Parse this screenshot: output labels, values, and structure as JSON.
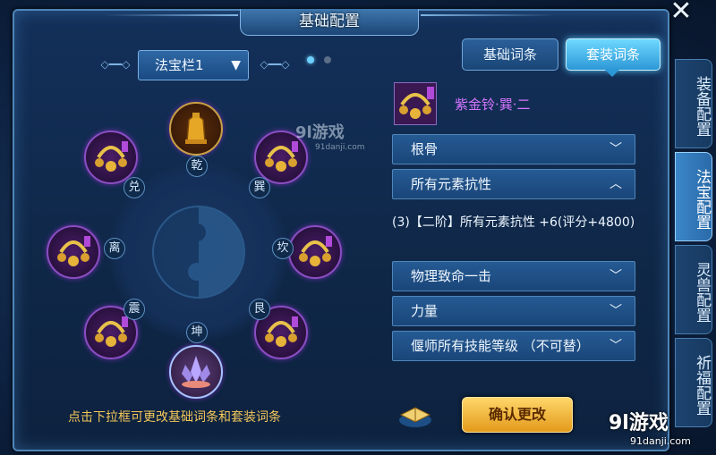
{
  "window": {
    "title": "基础配置",
    "close_label": "✕"
  },
  "selector": {
    "value": "法宝栏1",
    "page_count": 2,
    "active_page": 1
  },
  "wheel": {
    "trigrams": [
      "乾",
      "巽",
      "坎",
      "艮",
      "坤",
      "震",
      "离",
      "兑"
    ],
    "slots": [
      {
        "pos": "乾",
        "icon": "golden-bell-icon"
      },
      {
        "pos": "巽",
        "icon": "purple-bell-necklace-icon"
      },
      {
        "pos": "坎",
        "icon": "purple-bell-necklace-icon"
      },
      {
        "pos": "艮",
        "icon": "purple-bell-necklace-icon"
      },
      {
        "pos": "坤",
        "icon": "crystal-lotus-icon"
      },
      {
        "pos": "震",
        "icon": "purple-bell-necklace-icon"
      },
      {
        "pos": "离",
        "icon": "purple-bell-necklace-icon"
      },
      {
        "pos": "兑",
        "icon": "purple-bell-necklace-icon"
      }
    ]
  },
  "hint": "点击下拉框可更改基础词条和套装词条",
  "tabs": {
    "basic": "基础词条",
    "set": "套装词条",
    "active": "set"
  },
  "item": {
    "name": "紫金铃·巽·二",
    "icon": "purple-bell-necklace-icon"
  },
  "attributes": [
    {
      "label": "根骨",
      "expanded": false
    },
    {
      "label": "所有元素抗性",
      "expanded": true,
      "detail": "(3)【二阶】所有元素抗性 +6(评分+4800)"
    },
    {
      "label": "物理致命一击",
      "expanded": false
    },
    {
      "label": "力量",
      "expanded": false
    },
    {
      "label": "偃师所有技能等级 （不可替）",
      "expanded": false
    }
  ],
  "confirm_label": "确认更改",
  "side_tabs": [
    {
      "label": "装备配置",
      "active": false
    },
    {
      "label": "法宝配置",
      "active": true
    },
    {
      "label": "灵兽配置",
      "active": false
    },
    {
      "label": "祈福配置",
      "active": false
    }
  ],
  "watermark": {
    "brand": "9l游戏",
    "domain": "91danji.com"
  },
  "colors": {
    "accent": "#2c97d6",
    "gold": "#f4c75a",
    "item_name": "#d675ff",
    "confirm": "#e39a1b"
  }
}
